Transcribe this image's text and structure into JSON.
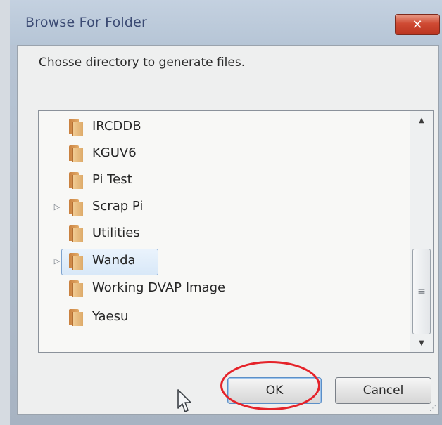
{
  "window": {
    "title": "Browse For Folder",
    "close_icon": "close-icon"
  },
  "dialog": {
    "prompt": "Chosse directory to generate files."
  },
  "folders": [
    {
      "label": "IRCDDB",
      "expandable": false,
      "selected": false
    },
    {
      "label": "KGUV6",
      "expandable": false,
      "selected": false
    },
    {
      "label": "Pi Test",
      "expandable": false,
      "selected": false
    },
    {
      "label": "Scrap Pi",
      "expandable": true,
      "selected": false
    },
    {
      "label": "Utilities",
      "expandable": false,
      "selected": false
    },
    {
      "label": "Wanda",
      "expandable": true,
      "selected": true
    },
    {
      "label": "Working DVAP Image",
      "expandable": false,
      "selected": false
    },
    {
      "label": "Yaesu",
      "expandable": false,
      "selected": false
    }
  ],
  "buttons": {
    "ok": "OK",
    "cancel": "Cancel"
  },
  "colors": {
    "annotation": "#e5232a",
    "close_button": "#cf4a33",
    "selection_border": "#7da2ce"
  }
}
